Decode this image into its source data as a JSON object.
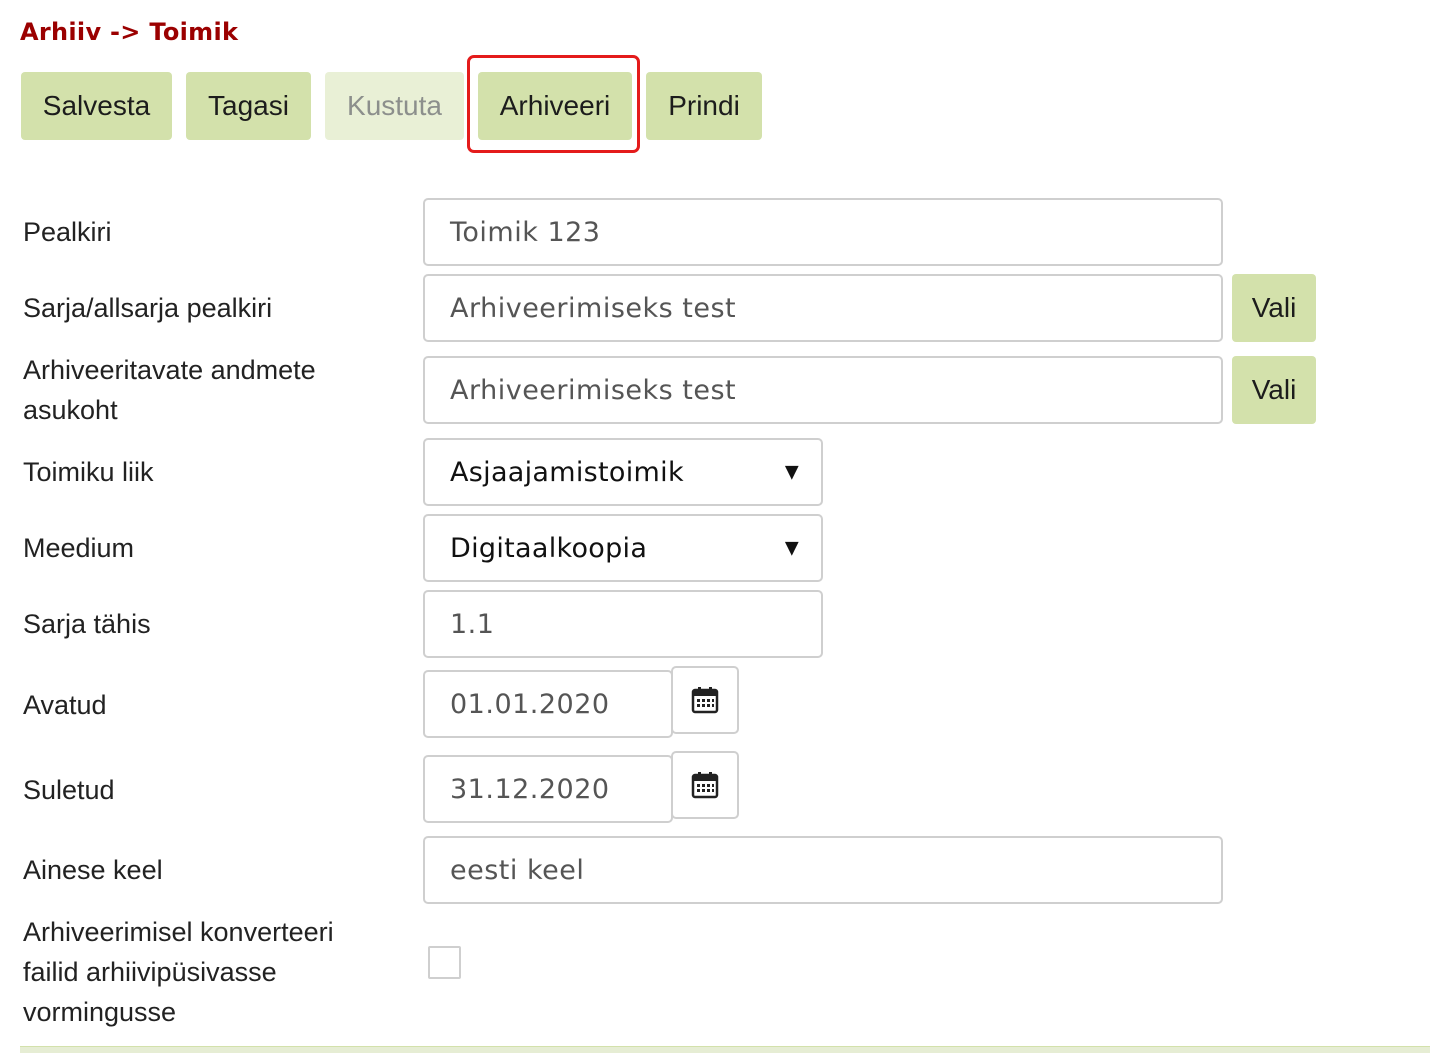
{
  "breadcrumb": "Arhiiv -> Toimik",
  "toolbar": {
    "save_label": "Salvesta",
    "back_label": "Tagasi",
    "delete_label": "Kustuta",
    "archive_label": "Arhiveeri",
    "print_label": "Prindi"
  },
  "form": {
    "title": {
      "label": "Pealkiri",
      "value": "Toimik 123"
    },
    "series_title": {
      "label": "Sarja/allsarja pealkiri",
      "value": "Arhiveerimiseks test",
      "button": "Vali"
    },
    "data_location": {
      "label_line1": "Arhiveeritavate andmete",
      "label_line2": "asukoht",
      "value": "Arhiveerimiseks test",
      "button": "Vali"
    },
    "file_type": {
      "label": "Toimiku liik",
      "value": "Asjaajamistoimik"
    },
    "medium": {
      "label": "Meedium",
      "value": "Digitaalkoopia"
    },
    "series_code": {
      "label": "Sarja tähis",
      "value": "1.1"
    },
    "opened": {
      "label": "Avatud",
      "value": "01.01.2020"
    },
    "closed": {
      "label": "Suletud",
      "value": "31.12.2020"
    },
    "language": {
      "label": "Ainese keel",
      "value": "eesti keel"
    },
    "convert": {
      "label_line1": "Arhiveerimisel konverteeri",
      "label_line2": "failid arhiivipüsivasse",
      "label_line3": "vormingusse",
      "checked": false
    }
  },
  "colors": {
    "breadcrumb": "#9b0000",
    "button_bg": "#d3e1ab",
    "button_disabled_bg": "#e9f0d6",
    "highlight": "#e41b1b"
  },
  "icons": {
    "calendar": "calendar-icon",
    "dropdown": "triangle-down"
  }
}
